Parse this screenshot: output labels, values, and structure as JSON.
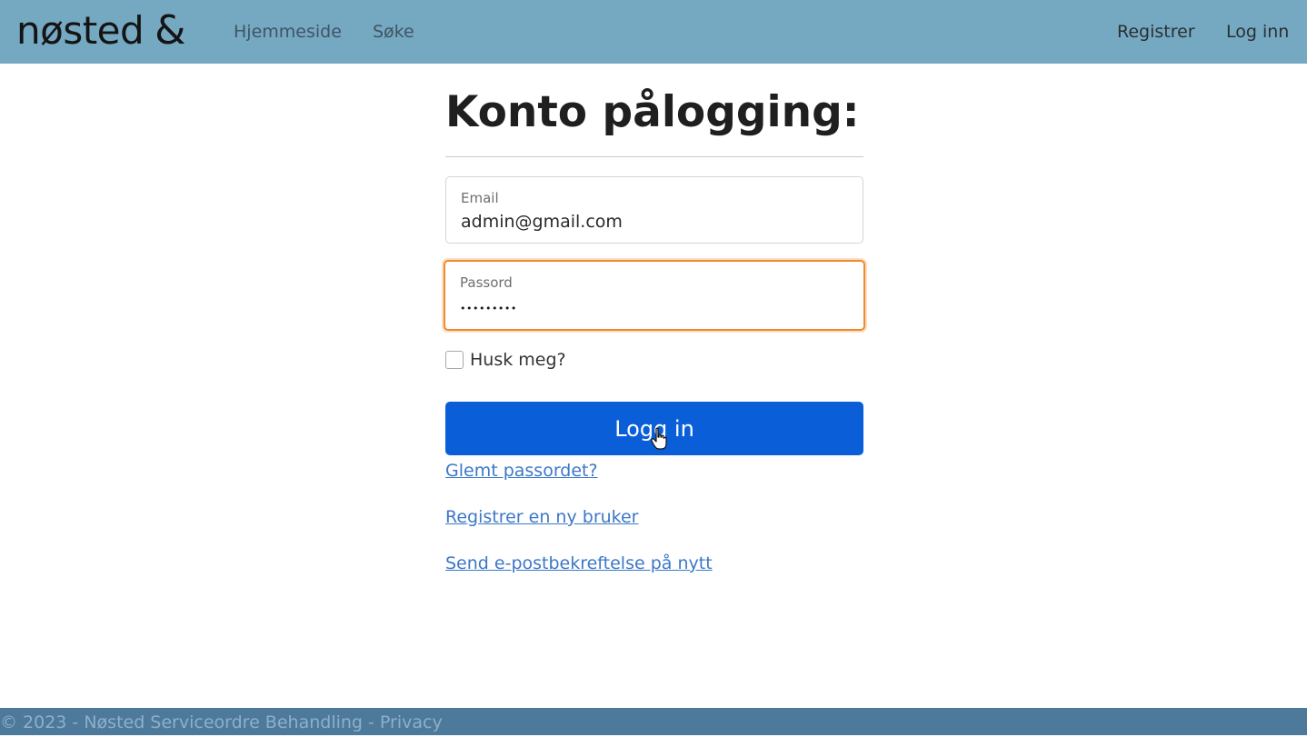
{
  "header": {
    "brand": "nøsted",
    "brand_mark": "&",
    "nav": {
      "home": "Hjemmeside",
      "search": "Søke",
      "register": "Registrer",
      "login": "Log inn"
    }
  },
  "login_form": {
    "title": "Konto pålogging:",
    "email": {
      "label": "Email",
      "value": "admin@gmail.com"
    },
    "password": {
      "label": "Passord",
      "value": "•••••••••"
    },
    "remember_label": "Husk meg?",
    "submit_label": "Logg in",
    "links": {
      "forgot": "Glemt passordet?",
      "register": "Registrer en ny bruker",
      "resend": "Send e-postbekreftelse på nytt"
    }
  },
  "footer": {
    "text": "© 2023 - Nøsted Serviceordre Behandling - Privacy"
  },
  "colors": {
    "navbar_bg": "#75a8c1",
    "primary_button": "#0a5fd9",
    "focus_ring": "#ef8a2b",
    "link": "#3c78c8",
    "footer_bg": "#4d7a9b"
  }
}
